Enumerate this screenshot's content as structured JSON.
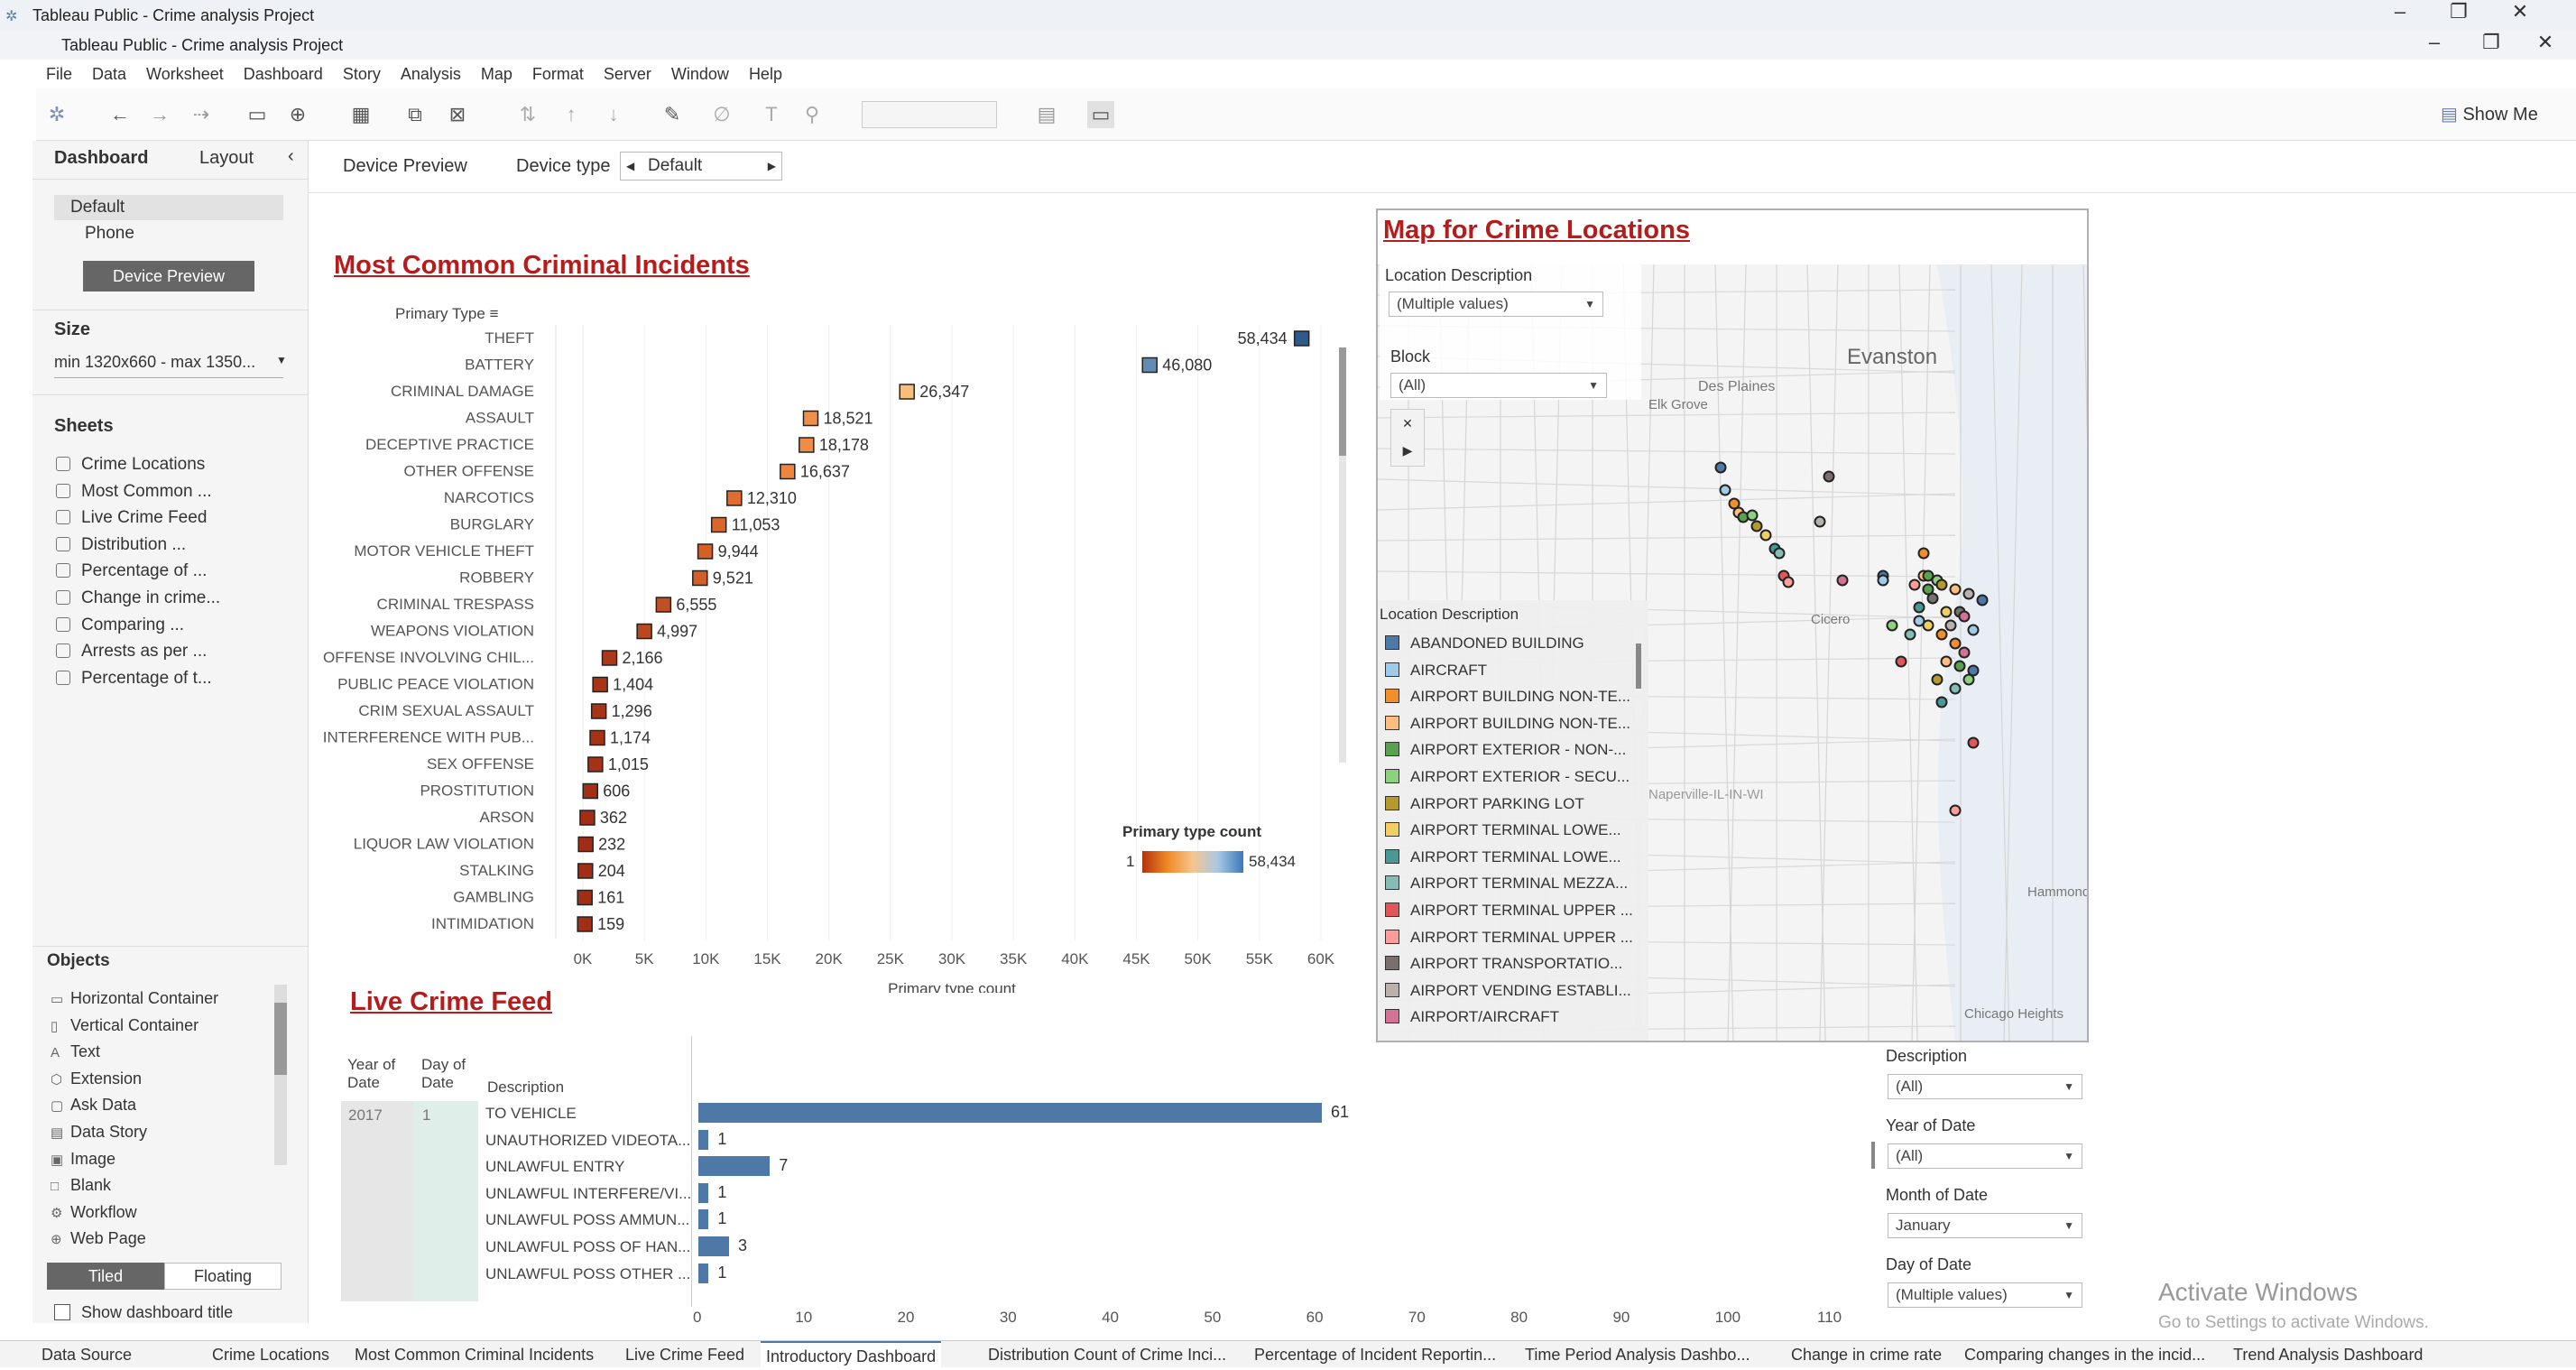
{
  "window": {
    "outer_title": "Tableau Public - Crime analysis Project",
    "inner_title": "Tableau Public - Crime analysis Project"
  },
  "menu": [
    "File",
    "Data",
    "Worksheet",
    "Dashboard",
    "Story",
    "Analysis",
    "Map",
    "Format",
    "Server",
    "Window",
    "Help"
  ],
  "toolbar": {
    "show_me": "Show Me"
  },
  "sidebar": {
    "tabs": {
      "dashboard": "Dashboard",
      "layout": "Layout"
    },
    "devices": [
      "Default",
      "Phone"
    ],
    "device_preview_button": "Device Preview",
    "size_label": "Size",
    "size_value": "min 1320x660 - max 1350...",
    "sheets_label": "Sheets",
    "sheets": [
      "Crime Locations",
      "Most Common ...",
      "Live Crime Feed",
      "Distribution ...",
      "Percentage of ...",
      "Change in crime...",
      "Comparing ...",
      "Arrests as per ...",
      "Percentage of t..."
    ],
    "objects_label": "Objects",
    "objects": [
      {
        "label": "Horizontal Container",
        "icon": "horizontal-container-icon"
      },
      {
        "label": "Vertical Container",
        "icon": "vertical-container-icon"
      },
      {
        "label": "Text",
        "icon": "text-icon"
      },
      {
        "label": "Extension",
        "icon": "extension-icon"
      },
      {
        "label": "Ask Data",
        "icon": "ask-data-icon"
      },
      {
        "label": "Data Story",
        "icon": "data-story-icon"
      },
      {
        "label": "Image",
        "icon": "image-icon"
      },
      {
        "label": "Blank",
        "icon": "blank-icon"
      },
      {
        "label": "Workflow",
        "icon": "workflow-icon"
      },
      {
        "label": "Web Page",
        "icon": "web-page-icon"
      }
    ],
    "tiled": "Tiled",
    "floating": "Floating",
    "show_title": "Show dashboard title"
  },
  "device_bar": {
    "preview": "Device Preview",
    "type_label": "Device type",
    "type_value": "Default"
  },
  "chart_title": "Most Common Criminal Incidents",
  "chart_data": {
    "type": "bar",
    "ylabel_header": "Primary Type",
    "xlabel": "Primary type count",
    "categories": [
      "THEFT",
      "BATTERY",
      "CRIMINAL DAMAGE",
      "ASSAULT",
      "DECEPTIVE PRACTICE",
      "OTHER OFFENSE",
      "NARCOTICS",
      "BURGLARY",
      "MOTOR VEHICLE THEFT",
      "ROBBERY",
      "CRIMINAL TRESPASS",
      "WEAPONS VIOLATION",
      "OFFENSE INVOLVING CHIL...",
      "PUBLIC PEACE VIOLATION",
      "CRIM SEXUAL ASSAULT",
      "INTERFERENCE WITH PUB...",
      "SEX OFFENSE",
      "PROSTITUTION",
      "ARSON",
      "LIQUOR LAW VIOLATION",
      "STALKING",
      "GAMBLING",
      "INTIMIDATION"
    ],
    "values": [
      58434,
      46080,
      26347,
      18521,
      18178,
      16637,
      12310,
      11053,
      9944,
      9521,
      6555,
      4997,
      2166,
      1404,
      1296,
      1174,
      1015,
      606,
      362,
      232,
      204,
      161,
      159
    ],
    "labels": [
      "58,434",
      "46,080",
      "26,347",
      "18,521",
      "18,178",
      "16,637",
      "12,310",
      "11,053",
      "9,944",
      "9,521",
      "6,555",
      "4,997",
      "2,166",
      "1,404",
      "1,296",
      "1,174",
      "1,015",
      "606",
      "362",
      "232",
      "204",
      "161",
      "159"
    ],
    "xticks": [
      "0K",
      "5K",
      "10K",
      "15K",
      "20K",
      "25K",
      "30K",
      "35K",
      "40K",
      "45K",
      "50K",
      "55K",
      "60K"
    ],
    "xlim": [
      0,
      60000
    ],
    "legend": {
      "title": "Primary type count",
      "min": "1",
      "max": "58,434",
      "placement": "bottom-right"
    }
  },
  "map": {
    "title": "Map for Crime Locations",
    "filter1_label": "Location Description",
    "filter1_value": "(Multiple values)",
    "filter2_label": "Block",
    "filter2_value": "(All)",
    "places": [
      "Evanston",
      "Des Plaines",
      "Elk Grove Village",
      "Cicero",
      "Naperville-IL-IN-WI",
      "Hammond",
      "Chicago Heights"
    ],
    "legend_title": "Location Description",
    "legend": [
      {
        "label": "ABANDONED BUILDING",
        "color": "#4e79a7"
      },
      {
        "label": "AIRCRAFT",
        "color": "#a0cbe8"
      },
      {
        "label": "AIRPORT BUILDING NON-TE...",
        "color": "#f28e2b"
      },
      {
        "label": "AIRPORT BUILDING NON-TE...",
        "color": "#ffbe7d"
      },
      {
        "label": "AIRPORT EXTERIOR - NON-...",
        "color": "#59a14f"
      },
      {
        "label": "AIRPORT EXTERIOR - SECU...",
        "color": "#8cd17d"
      },
      {
        "label": "AIRPORT PARKING LOT",
        "color": "#b6992d"
      },
      {
        "label": "AIRPORT TERMINAL LOWE...",
        "color": "#f1ce63"
      },
      {
        "label": "AIRPORT TERMINAL LOWE...",
        "color": "#499894"
      },
      {
        "label": "AIRPORT TERMINAL MEZZA...",
        "color": "#86bcb6"
      },
      {
        "label": "AIRPORT TERMINAL UPPER ...",
        "color": "#e15759"
      },
      {
        "label": "AIRPORT TERMINAL UPPER ...",
        "color": "#ff9d9a"
      },
      {
        "label": "AIRPORT TRANSPORTATIO...",
        "color": "#79706e"
      },
      {
        "label": "AIRPORT VENDING ESTABLI...",
        "color": "#bab0ac"
      },
      {
        "label": "AIRPORT/AIRCRAFT",
        "color": "#d37295"
      }
    ]
  },
  "feed": {
    "title": "Live Crime Feed",
    "col_year": "Year of Date",
    "col_day": "Day of Date",
    "col_desc": "Description",
    "year": "2017",
    "day": "1",
    "rows": [
      {
        "desc": "TO VEHICLE",
        "v": 61,
        "label": "61"
      },
      {
        "desc": "UNAUTHORIZED VIDEOTA...",
        "v": 1,
        "label": "1"
      },
      {
        "desc": "UNLAWFUL ENTRY",
        "v": 7,
        "label": "7"
      },
      {
        "desc": "UNLAWFUL INTERFERE/VI...",
        "v": 1,
        "label": "1"
      },
      {
        "desc": "UNLAWFUL POSS AMMUN...",
        "v": 1,
        "label": "1"
      },
      {
        "desc": "UNLAWFUL POSS OF HAN...",
        "v": 3,
        "label": "3"
      },
      {
        "desc": "UNLAWFUL POSS OTHER ...",
        "v": 1,
        "label": "1"
      }
    ],
    "xticks": [
      "0",
      "10",
      "20",
      "30",
      "40",
      "50",
      "60",
      "70",
      "80",
      "90",
      "100",
      "110"
    ]
  },
  "filters": [
    {
      "label": "Description",
      "value": "(All)"
    },
    {
      "label": "Year of Date",
      "value": "(All)"
    },
    {
      "label": "Month of Date",
      "value": "January"
    },
    {
      "label": "Day of Date",
      "value": "(Multiple values)"
    }
  ],
  "watermark": {
    "line1": "Activate Windows",
    "line2": "Go to Settings to activate Windows."
  },
  "tabs": [
    "Data Source",
    "Crime Locations",
    "Most Common Criminal Incidents",
    "Live Crime Feed",
    "Introductory Dashboard",
    "Distribution Count of Crime Inci...",
    "Percentage of Incident Reportin...",
    "Time Period Analysis Dashbo...",
    "Change in crime rate",
    "Comparing changes in the incid...",
    "Trend Analysis Dashboard"
  ]
}
